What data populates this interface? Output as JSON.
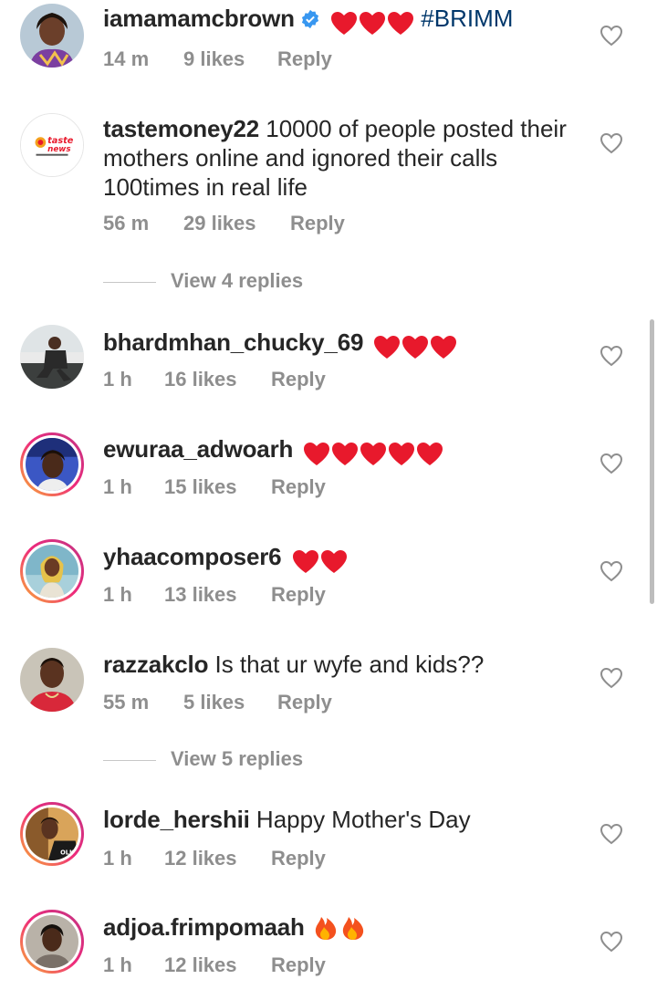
{
  "colors": {
    "username": "#262626",
    "meta": "#8e8e8e",
    "hashtag": "#00376b",
    "heart": "#e8192c",
    "verified": "#3897f0"
  },
  "comments": [
    {
      "username": "iamamamcbrown",
      "verified": true,
      "text": "",
      "emoji": "hearts-3",
      "hashtag": "#BRIMM",
      "time": "14 m",
      "likes": "9 likes",
      "reply": "Reply"
    },
    {
      "username": "tastemoney22",
      "text": " 10000  of people posted their mothers online and ignored their calls 100times in real life",
      "time": "56 m",
      "likes": "29 likes",
      "reply": "Reply",
      "avatar_text": "taste news"
    },
    {
      "username": "bhardmhan_chucky_69",
      "text": "",
      "emoji": "hearts-3",
      "time": "1 h",
      "likes": "16 likes",
      "reply": "Reply"
    },
    {
      "username": "ewuraa_adwoarh",
      "text": "",
      "emoji": "hearts-5",
      "time": "1 h",
      "likes": "15 likes",
      "reply": "Reply"
    },
    {
      "username": "yhaacomposer6",
      "text": "",
      "emoji": "hearts-2",
      "time": "1 h",
      "likes": "13 likes",
      "reply": "Reply"
    },
    {
      "username": "razzakclo",
      "text": " Is that ur wyfe and kids??",
      "time": "55 m",
      "likes": "5 likes",
      "reply": "Reply"
    },
    {
      "username": "lorde_hershii",
      "text": " Happy Mother's Day",
      "time": "1 h",
      "likes": "12 likes",
      "reply": "Reply"
    },
    {
      "username": "adjoa.frimpomaah",
      "text": "",
      "emoji": "fire-2",
      "time": "1 h",
      "likes": "12 likes",
      "reply": "Reply"
    }
  ],
  "view_replies": [
    {
      "label": "View 4 replies"
    },
    {
      "label": "View 5 replies"
    }
  ],
  "icons": {
    "like": "heart-outline-icon",
    "verified": "verified-badge-icon"
  }
}
